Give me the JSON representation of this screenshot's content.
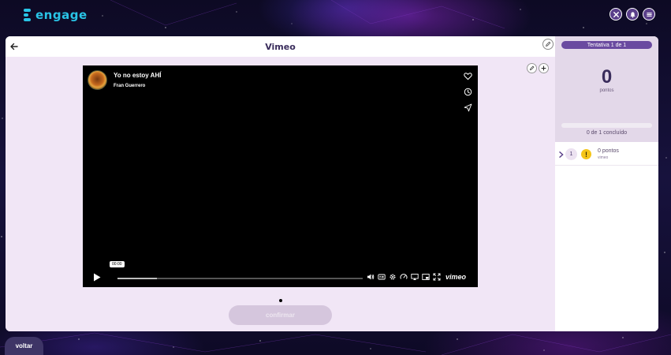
{
  "brand": {
    "name": "engage",
    "accent": "#29c4e6"
  },
  "header": {
    "icons": [
      "tools-icon",
      "bell-icon",
      "menu-icon"
    ]
  },
  "activity": {
    "title": "Vimeo",
    "back_icon": "arrow-left-icon",
    "edit_icon": "pencil-icon"
  },
  "video": {
    "title": "Yo no estoy AHÍ",
    "author": "Fran Guerrero",
    "timecode": "00:00",
    "progress_fraction": 0.16,
    "brand_label": "vimeo",
    "side_icons": [
      "heart-icon",
      "clock-icon",
      "send-icon"
    ],
    "control_icons": [
      "volume-icon",
      "captions-icon",
      "settings-icon",
      "speed-icon",
      "pip-icon",
      "airplay-icon",
      "fullscreen-icon"
    ]
  },
  "confirm_label": "confirmar",
  "side": {
    "attempt_label": "Tentativa 1 de 1",
    "score": "0",
    "score_label": "pontos",
    "completed_text": "0 de 1 concluído",
    "completed_fraction": 0,
    "questions": [
      {
        "number": "1",
        "points": "0 pontos",
        "type": "vimeo",
        "status": "!"
      }
    ]
  },
  "back_button_label": "voltar",
  "colors": {
    "primary": "#6a4aa0",
    "content_bg": "#f1e6f6",
    "panel_bg": "#e3d8e9",
    "warning": "#f5c518"
  }
}
